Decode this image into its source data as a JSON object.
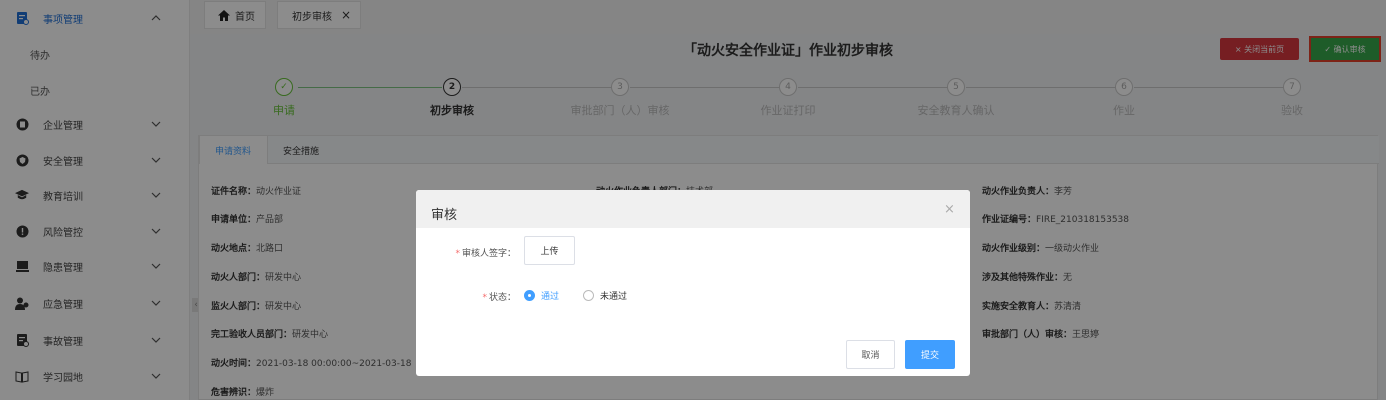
{
  "sidebar": {
    "items": [
      {
        "label": "事项管理",
        "icon": "document-icon"
      },
      {
        "label": "待办",
        "icon": ""
      },
      {
        "label": "已办",
        "icon": ""
      },
      {
        "label": "企业管理",
        "icon": "building-icon"
      },
      {
        "label": "安全管理",
        "icon": "shield-icon"
      },
      {
        "label": "教育培训",
        "icon": "graduation-icon"
      },
      {
        "label": "风险管控",
        "icon": "warning-icon"
      },
      {
        "label": "隐患管理",
        "icon": "monitor-icon"
      },
      {
        "label": "应急管理",
        "icon": "people-icon"
      },
      {
        "label": "事故管理",
        "icon": "report-icon"
      },
      {
        "label": "学习园地",
        "icon": "book-icon"
      }
    ]
  },
  "tabs": {
    "home": "首页",
    "current": "初步审核",
    "close": "×"
  },
  "header": {
    "title": "「动火安全作业证」作业初步审核",
    "close_page_label": "× 关闭当前页",
    "confirm_label": "✓ 确认审核"
  },
  "steps": [
    {
      "label": "申请",
      "num": "✓",
      "status": "done"
    },
    {
      "label": "初步审核",
      "num": "2",
      "status": "process"
    },
    {
      "label": "审批部门（人）审核",
      "num": "3",
      "status": "wait"
    },
    {
      "label": "作业证打印",
      "num": "4",
      "status": "wait"
    },
    {
      "label": "安全教育人确认",
      "num": "5",
      "status": "wait"
    },
    {
      "label": "作业",
      "num": "6",
      "status": "wait"
    },
    {
      "label": "验收",
      "num": "7",
      "status": "wait"
    }
  ],
  "content_tabs": {
    "tab1": "申请资料",
    "tab2": "安全措施"
  },
  "fields": {
    "cert_name_label": "证件名称：",
    "cert_name": "动火作业证",
    "apply_unit_label": "申请单位：",
    "apply_unit": "产品部",
    "fire_location_label": "动火地点：",
    "fire_location": "北路口",
    "fire_dept_label": "动火人部门：",
    "fire_dept": "研发中心",
    "supervisor_dept_label": "监火人部门：",
    "supervisor_dept": "研发中心",
    "acceptance_dept_label": "完工验收人员部门：",
    "acceptance_dept": "研发中心",
    "fire_time_label": "动火时间：",
    "fire_time": "2021-03-18 00:00:00~2021-03-18",
    "hazard_label": "危害辨识：",
    "hazard": "爆炸",
    "resp_dept_label": "动火作业负责人部门：",
    "resp_dept": "技术部",
    "resp_person_label": "动火作业负责人：",
    "resp_person": "李芳",
    "cert_no_label": "作业证编号：",
    "cert_no": "FIRE_210318153538",
    "level_label": "动火作业级别：",
    "level": "一级动火作业",
    "other_special_label": "涉及其他特殊作业：",
    "other_special": "无",
    "educator_label": "实施安全教育人：",
    "educator": "苏清清",
    "approver_label": "审批部门（人）审核：",
    "approver": "王思婷"
  },
  "dialog": {
    "title": "审核",
    "close": "×",
    "signature_label": "审核人签字：",
    "upload_label": "上传",
    "status_label": "状态：",
    "option_pass": "通过",
    "option_fail": "未通过",
    "selected": "通过",
    "cancel_label": "取消",
    "submit_label": "提交"
  },
  "colors": {
    "primary": "#409eff",
    "success": "#67c23a",
    "danger": "#d8373f",
    "confirm_btn": "#38a84b",
    "sidebar_active": "#1f6fd6"
  }
}
